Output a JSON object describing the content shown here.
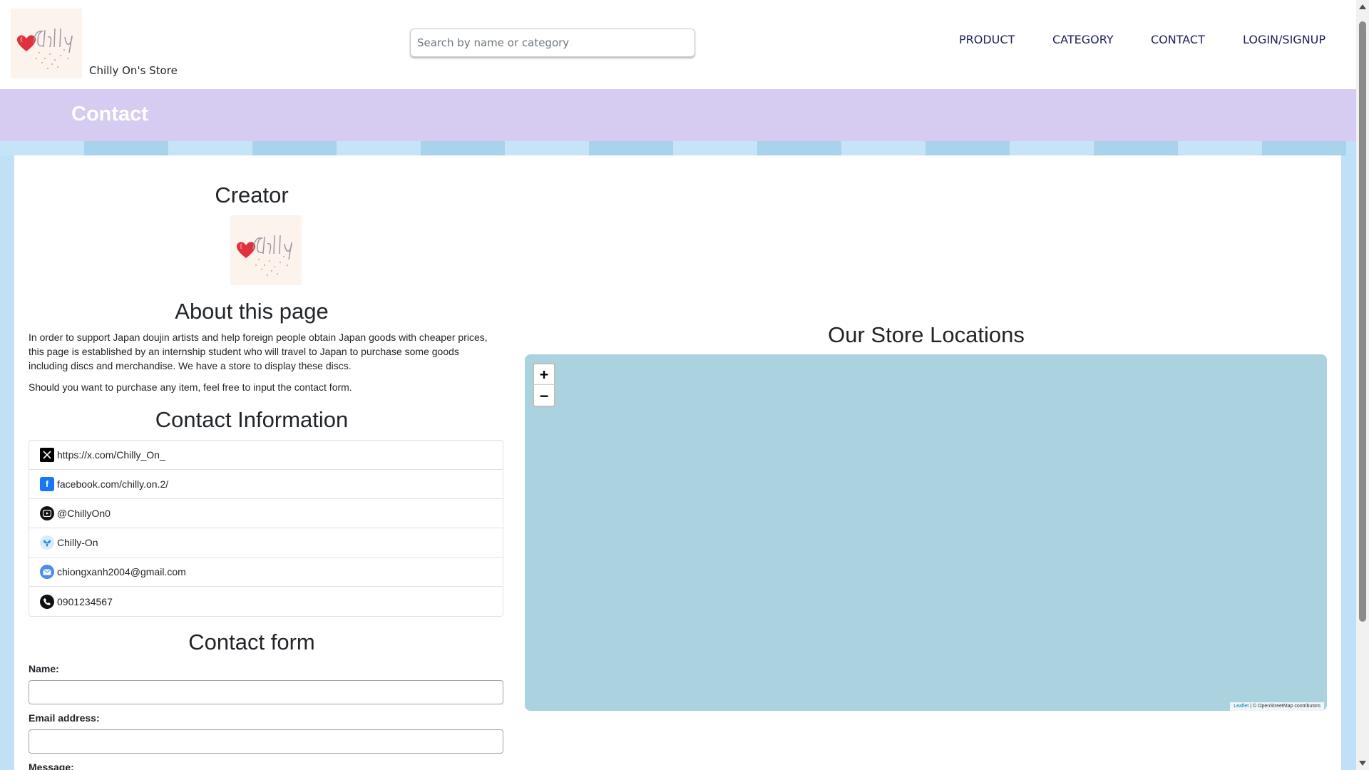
{
  "header": {
    "store_name": "Chilly On's Store",
    "logo_icon": "chilly-on-logo",
    "search_placeholder": "Search by name or category",
    "nav": [
      "PRODUCT",
      "CATEGORY",
      "CONTACT",
      "LOGIN/SIGNUP"
    ]
  },
  "banner": {
    "title": "Contact"
  },
  "creator": {
    "title": "Creator"
  },
  "about": {
    "title": "About this page",
    "paragraph1": "In order to support Japan doujin artists and help foreign people obtain Japan goods with cheaper prices, this page is established by an internship student who will travel to Japan to purchase some goods including discs and merchandise. We have a store to display these discs.",
    "paragraph2": "Should you want to purchase any item, feel free to input the contact form."
  },
  "contact_info": {
    "title": "Contact Information",
    "items": [
      {
        "icon": "x-twitter-icon",
        "text": "https://x.com/Chilly_On_"
      },
      {
        "icon": "facebook-icon",
        "text": "facebook.com/chilly.on.2/"
      },
      {
        "icon": "youtube-icon",
        "text": "@ChillyOn0"
      },
      {
        "icon": "bluesky-icon",
        "text": "Chilly-On"
      },
      {
        "icon": "email-icon",
        "text": "chiongxanh2004@gmail.com"
      },
      {
        "icon": "phone-icon",
        "text": "0901234567"
      }
    ]
  },
  "form": {
    "title": "Contact form",
    "name_label": "Name:",
    "email_label": "Email address:",
    "message_label": "Message:",
    "name_value": "",
    "email_value": ""
  },
  "map": {
    "title": "Our Store Locations",
    "zoom_in": "+",
    "zoom_out": "−",
    "attribution_leaflet": "Leaflet",
    "attribution_osm": "| © OpenStreetMap contributors"
  },
  "colors": {
    "banner": "#d6cbf0",
    "backdrop": "#bfe0f6",
    "map_water": "#aad3df",
    "nav_text": "#1d1d5e"
  }
}
